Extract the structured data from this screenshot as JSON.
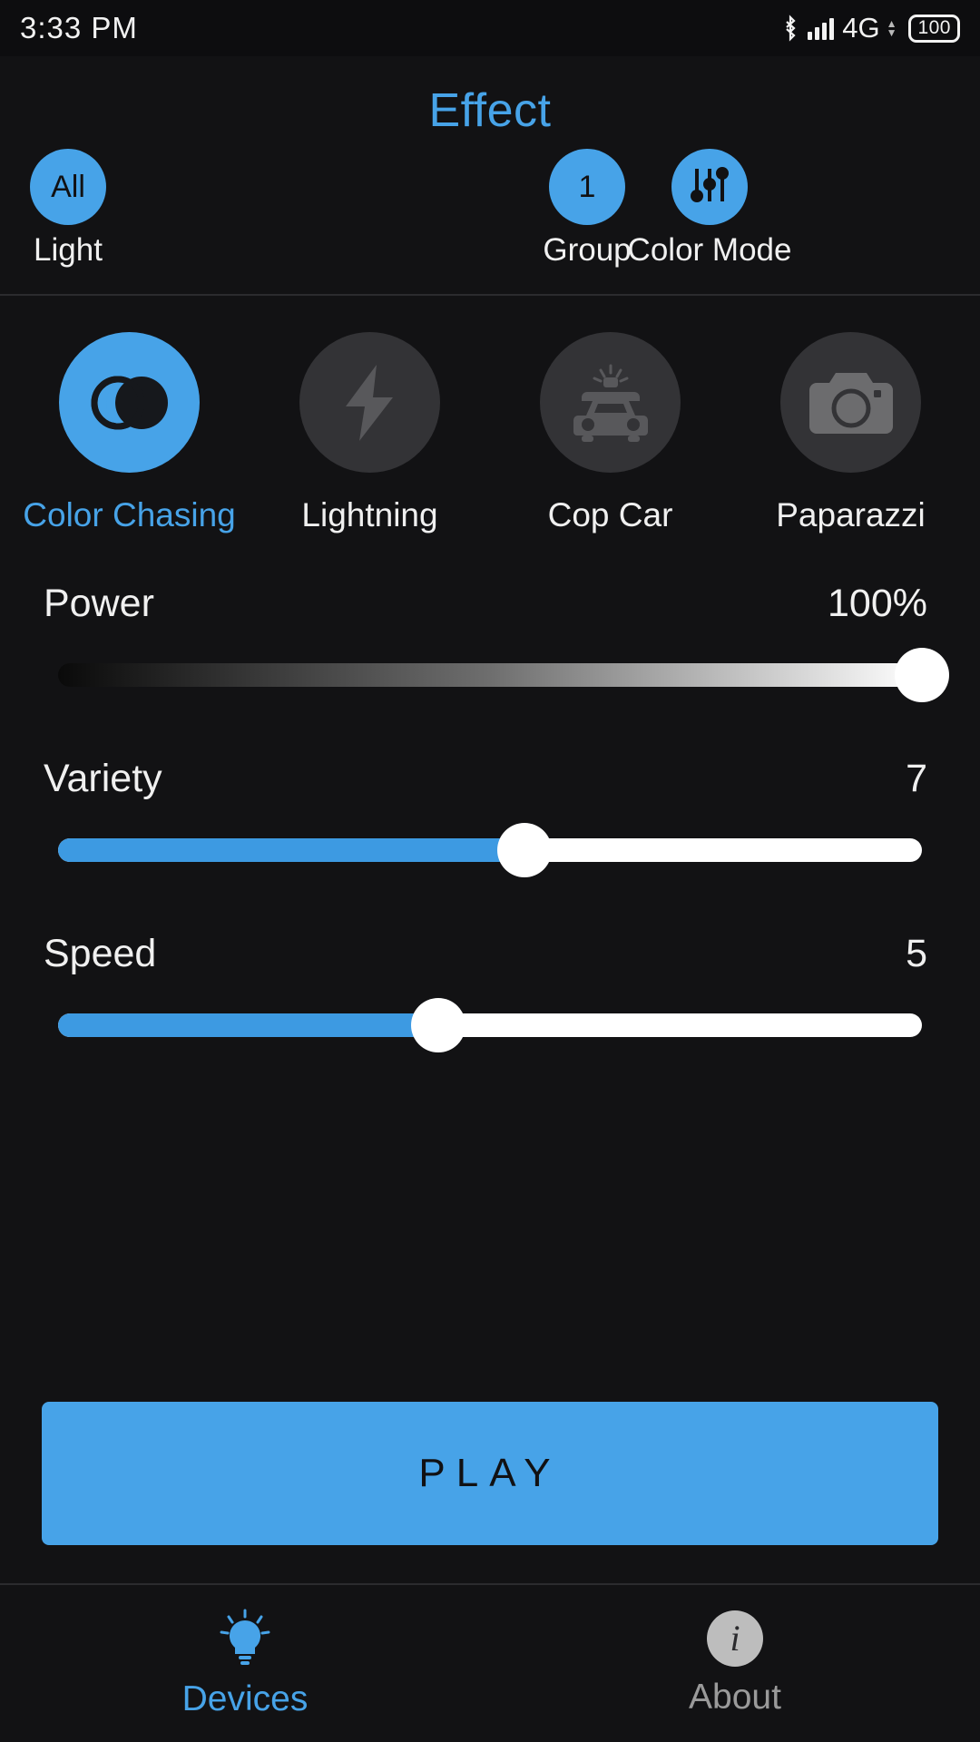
{
  "statusbar": {
    "time": "3:33 PM",
    "network": "4G",
    "battery": "100",
    "bluetooth_icon": "bluetooth-icon",
    "signal_icon": "signal-bars-icon",
    "battery_icon": "battery-icon"
  },
  "header": {
    "title": "Effect",
    "controls": [
      {
        "badge": "All",
        "label": "Light",
        "icon": "all-lights-icon"
      },
      {
        "badge": "1",
        "label": "Group",
        "icon": "group-number-icon"
      },
      {
        "badge": "",
        "label": "Color Mode",
        "icon": "sliders-icon"
      }
    ]
  },
  "effects": {
    "items": [
      {
        "label": "Color Chasing",
        "icon": "overlapping-circles-icon",
        "selected": true
      },
      {
        "label": "Lightning",
        "icon": "lightning-bolt-icon",
        "selected": false
      },
      {
        "label": "Cop Car",
        "icon": "police-car-icon",
        "selected": false
      },
      {
        "label": "Paparazzi",
        "icon": "camera-icon",
        "selected": false
      }
    ]
  },
  "sliders": [
    {
      "name": "Power",
      "value": "100%",
      "percent": 100,
      "style": "gradient"
    },
    {
      "name": "Variety",
      "value": "7",
      "percent": 54,
      "style": "plain"
    },
    {
      "name": "Speed",
      "value": "5",
      "percent": 44,
      "style": "plain"
    }
  ],
  "play": {
    "label": "PLAY"
  },
  "bottom_nav": {
    "items": [
      {
        "label": "Devices",
        "icon": "lightbulb-icon",
        "active": true
      },
      {
        "label": "About",
        "icon": "info-icon",
        "active": false
      }
    ]
  },
  "colors": {
    "accent": "#47a3e8",
    "background": "#121214",
    "tile_inactive": "#333336",
    "text": "#f0f0f0"
  }
}
